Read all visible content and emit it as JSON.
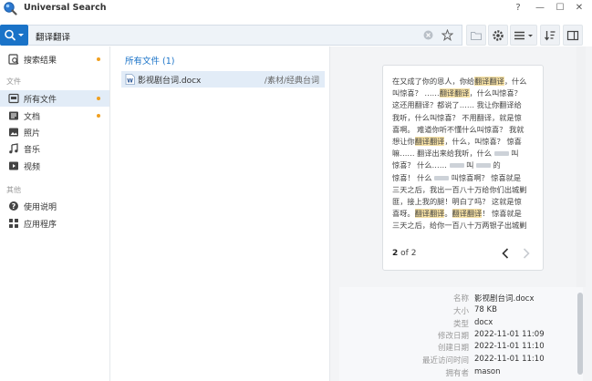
{
  "window": {
    "title": "Universal Search",
    "help_glyph": "?",
    "minimize_glyph": "—",
    "maximize_glyph": "☐",
    "close_glyph": "✕"
  },
  "search": {
    "query": "翻译翻译"
  },
  "sidebar": {
    "items": [
      {
        "label": "搜索结果",
        "icon": "search-results-icon",
        "dot": true
      },
      {
        "section": "文件"
      },
      {
        "label": "所有文件",
        "icon": "files-icon",
        "dot": true,
        "active": true
      },
      {
        "label": "文档",
        "icon": "document-icon",
        "dot": true
      },
      {
        "label": "照片",
        "icon": "photo-icon"
      },
      {
        "label": "音乐",
        "icon": "music-icon"
      },
      {
        "label": "视频",
        "icon": "video-icon"
      },
      {
        "section": "其他"
      },
      {
        "label": "使用说明",
        "icon": "help-icon"
      },
      {
        "label": "应用程序",
        "icon": "apps-icon"
      }
    ]
  },
  "results": {
    "header": "所有文件 (1)",
    "files": [
      {
        "name": "影视剧台词.docx",
        "path": "/素材/经典台词",
        "icon": "word-doc-icon"
      }
    ]
  },
  "preview": {
    "text_lines": [
      "在又成了你的恩人，你给",
      "叫惊喜？ ……",
      "这还用翻译？都说了…… 我让你翻译给",
      "我听，什么叫惊喜？ 不用翻译，就是惊",
      "喜啊。 难道你听不懂什么叫惊喜？ 我就",
      "想让你",
      "嘛…… 翻译出来给我听，什么",
      "惊喜？ 什么……",
      "惊喜！ 什么",
      "三天之后，我出一百八十万给你们出城剿",
      "匪，接上我的腿！明白了吗？ 这就是惊",
      "喜呀。",
      "三天之后，给你一百八十万两银子出城剿"
    ],
    "highlight": "翻译翻译",
    "page_current": "2",
    "page_of": "of",
    "page_total": "2",
    "info": [
      {
        "key": "名称",
        "value": "影视剧台词.docx"
      },
      {
        "key": "大小",
        "value": "78 KB"
      },
      {
        "key": "类型",
        "value": "docx"
      },
      {
        "key": "修改日期",
        "value": "2022-11-01 11:09"
      },
      {
        "key": "创建日期",
        "value": "2022-11-01 11:10"
      },
      {
        "key": "最近访问时间",
        "value": "2022-11-01 11:10"
      },
      {
        "key": "拥有者",
        "value": "mason"
      }
    ]
  },
  "colors": {
    "accent": "#1a73c8",
    "highlight": "#f7e2a6",
    "dot": "#f0a020"
  }
}
